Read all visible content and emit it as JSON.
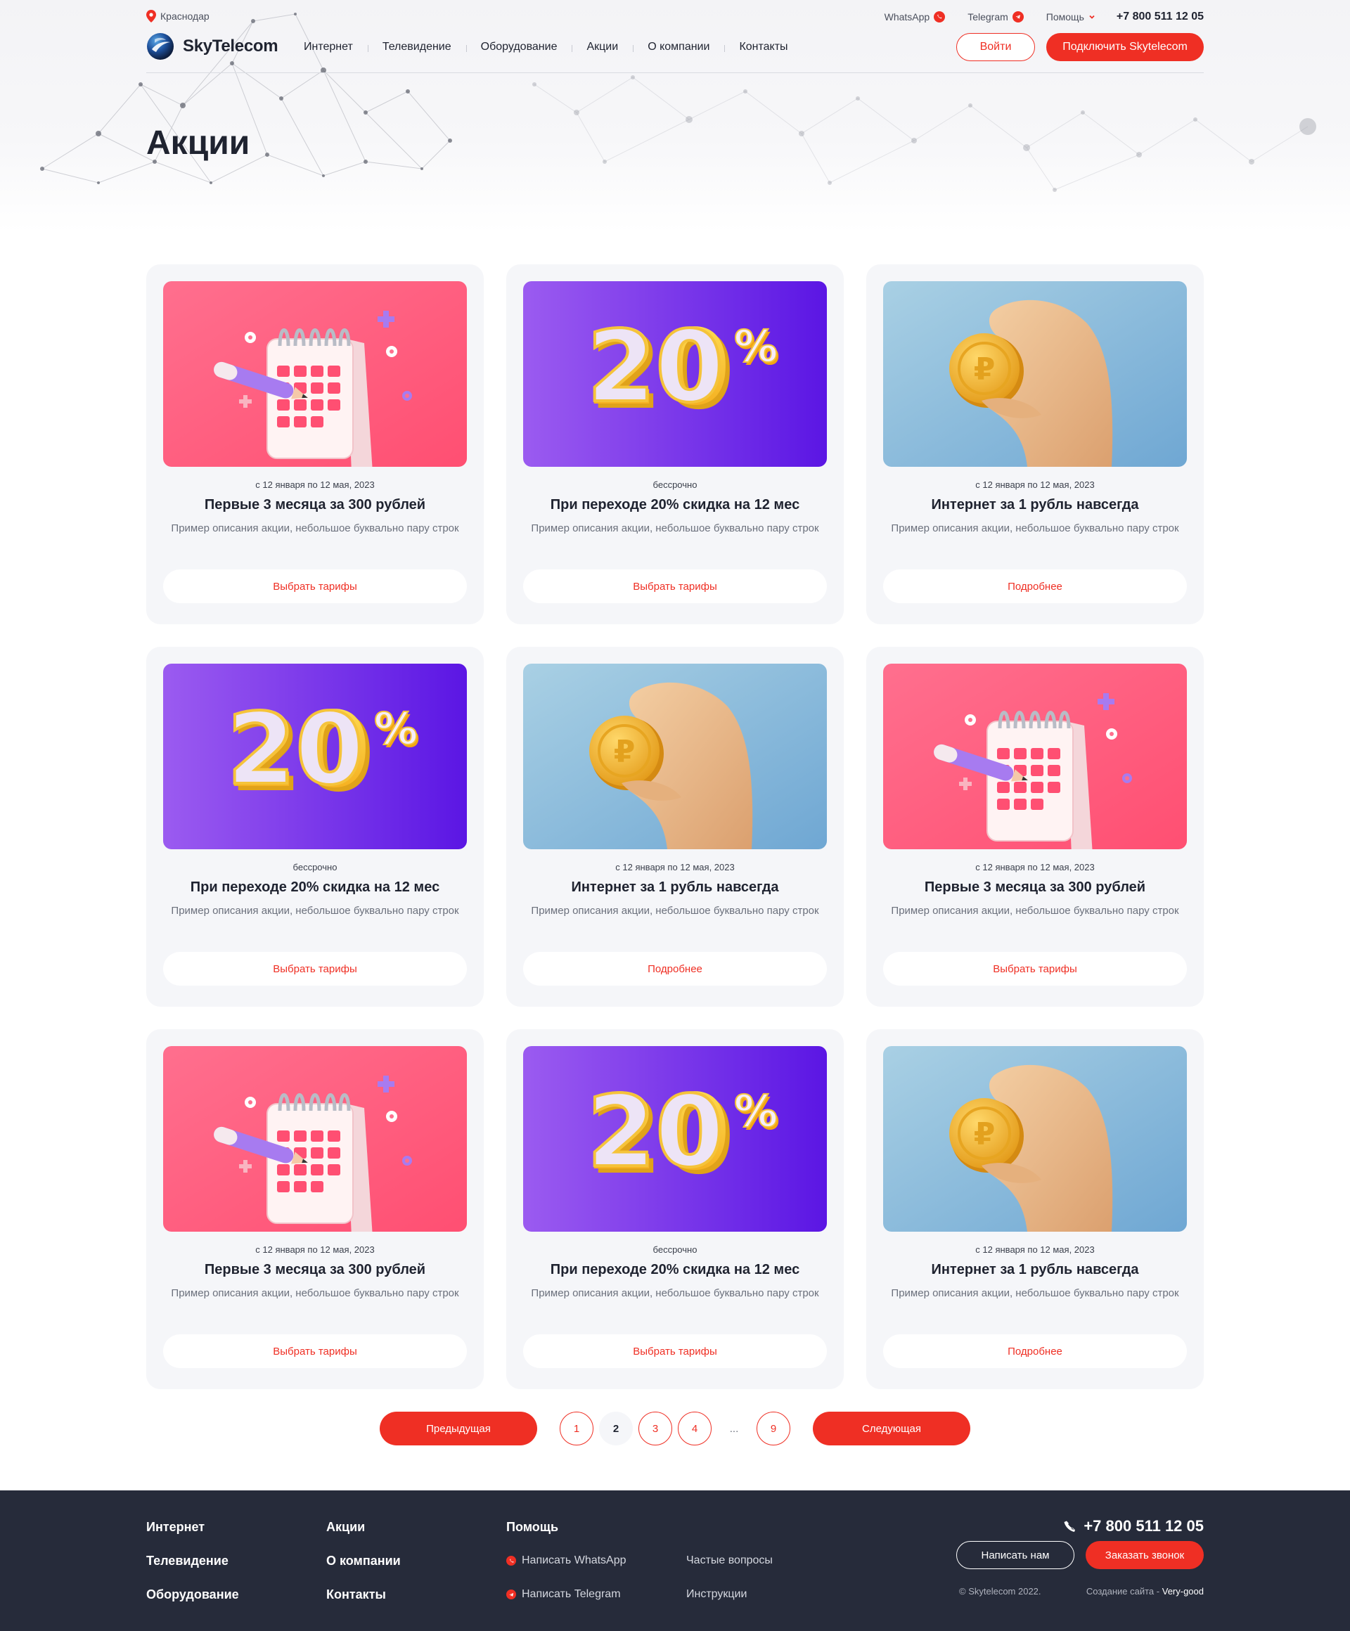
{
  "header": {
    "city": "Краснодар",
    "whatsapp": "WhatsApp",
    "telegram": "Telegram",
    "help": "Помощь",
    "phone": "+7 800 511 12 05",
    "logo_text": "SkyTelecom",
    "menu": [
      "Интернет",
      "Телевидение",
      "Оборудование",
      "Акции",
      "О компании",
      "Контакты"
    ],
    "login": "Войти",
    "connect": "Подключить Skytelecom"
  },
  "page_title": "Акции",
  "cards": [
    {
      "image": "calendar",
      "date": "с 12 января по 12 мая, 2023",
      "title": "Первые 3 месяца за 300 рублей",
      "desc": "Пример описания акции, небольшое буквально пару строк",
      "button": "Выбрать тарифы"
    },
    {
      "image": "percent",
      "date": "бессрочно",
      "title": "При переходе 20% скидка на 12 мес",
      "desc": "Пример описания акции, небольшое буквально пару строк",
      "button": "Выбрать тарифы"
    },
    {
      "image": "coin",
      "date": "с 12 января по 12 мая, 2023",
      "title": "Интернет за 1 рубль навсегда",
      "desc": "Пример описания акции, небольшое буквально пару строк",
      "button": "Подробнее"
    },
    {
      "image": "percent",
      "date": "бессрочно",
      "title": "При переходе 20% скидка на 12 мес",
      "desc": "Пример описания акции, небольшое буквально пару строк",
      "button": "Выбрать тарифы"
    },
    {
      "image": "coin",
      "date": "с 12 января по 12 мая, 2023",
      "title": "Интернет за 1 рубль навсегда",
      "desc": "Пример описания акции, небольшое буквально пару строк",
      "button": "Подробнее"
    },
    {
      "image": "calendar",
      "date": "с 12 января по 12 мая, 2023",
      "title": "Первые 3 месяца за 300 рублей",
      "desc": "Пример описания акции, небольшое буквально пару строк",
      "button": "Выбрать тарифы"
    },
    {
      "image": "calendar",
      "date": "с 12 января по 12 мая, 2023",
      "title": "Первые 3 месяца за 300 рублей",
      "desc": "Пример описания акции, небольшое буквально пару строк",
      "button": "Выбрать тарифы"
    },
    {
      "image": "percent",
      "date": "бессрочно",
      "title": "При переходе 20% скидка на 12 мес",
      "desc": "Пример описания акции, небольшое буквально пару строк",
      "button": "Выбрать тарифы"
    },
    {
      "image": "coin",
      "date": "с 12 января по 12 мая, 2023",
      "title": "Интернет за 1 рубль навсегда",
      "desc": "Пример описания акции, небольшое буквально пару строк",
      "button": "Подробнее"
    }
  ],
  "pagination": {
    "prev": "Предыдущая",
    "next": "Следующая",
    "pages": [
      "1",
      "2",
      "3",
      "4",
      "...",
      "9"
    ],
    "current": "2"
  },
  "footer": {
    "col1": [
      "Интернет",
      "Телевидение",
      "Оборудование"
    ],
    "col2": [
      "Акции",
      "О компании",
      "Контакты"
    ],
    "help_title": "Помощь",
    "help_links": [
      "Написать WhatsApp",
      "Написать Telegram"
    ],
    "help_links2": [
      "Частые вопросы",
      "Инструкции"
    ],
    "phone": "+7 800 511 12 05",
    "write_us": "Написать нам",
    "order_call": "Заказать звонок",
    "copyright": "© Skytelecom 2022.",
    "created_by_label": "Создание сайта -",
    "created_by": "Very-good"
  },
  "colors": {
    "accent": "#ef2f24",
    "card_bg": "#f5f6f9",
    "footer_bg": "#262b3a",
    "text": "#1f2330"
  }
}
